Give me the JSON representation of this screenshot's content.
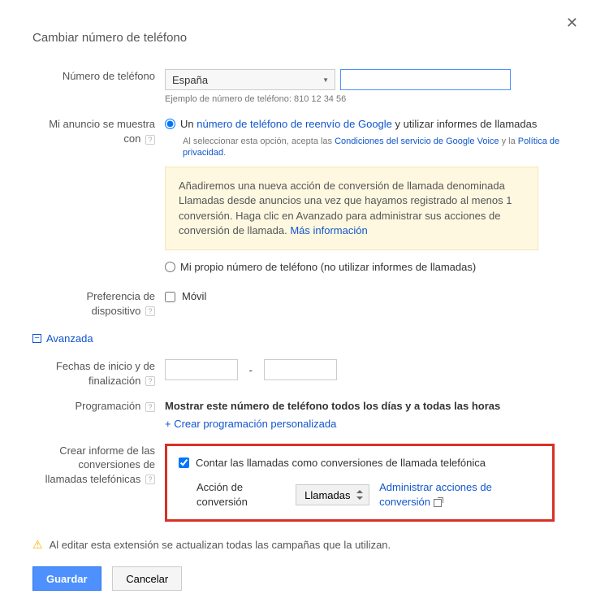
{
  "dialog": {
    "title": "Cambiar número de teléfono"
  },
  "phone": {
    "label": "Número de teléfono",
    "country": "España",
    "value": "",
    "example": "Ejemplo de número de teléfono: 810 12 34 56"
  },
  "display_with": {
    "label_line1": "Mi anuncio se muestra",
    "label_line2": "con",
    "option1_prefix": "Un ",
    "option1_link": "número de teléfono de reenvío de Google",
    "option1_suffix": " y utilizar informes de llamadas",
    "fineprint_prefix": "Al seleccionar esta opción, acepta las ",
    "fineprint_link1": "Condiciones del servicio de Google Voice",
    "fineprint_mid": " y la ",
    "fineprint_link2": "Política de privacidad",
    "fineprint_end": ".",
    "info_box": "Añadiremos una nueva acción de conversión de llamada denominada Llamadas desde anuncios una vez que hayamos registrado al menos 1 conversión. Haga clic en Avanzado para administrar sus acciones de conversión de llamada. ",
    "info_box_link": "Más información",
    "option2": "Mi propio número de teléfono (no utilizar informes de llamadas)"
  },
  "device_pref": {
    "label_line1": "Preferencia de",
    "label_line2": "dispositivo",
    "mobile": "Móvil"
  },
  "advanced": {
    "label": "Avanzada",
    "toggle_state": "−"
  },
  "dates": {
    "label_line1": "Fechas de inicio y de",
    "label_line2": "finalización",
    "start": "",
    "end": ""
  },
  "schedule": {
    "label": "Programación",
    "title": "Mostrar este número de teléfono todos los días y a todas las horas",
    "create_link": "+ Crear programación personalizada"
  },
  "report": {
    "label_line1": "Crear informe de las",
    "label_line2": "conversiones de",
    "label_line3": "llamadas telefónicas",
    "count_label": "Contar las llamadas como conversiones de llamada telefónica",
    "action_label": "Acción de conversión",
    "action_value": "Llamadas",
    "manage_link": "Administrar acciones de conversión"
  },
  "warning": "Al editar esta extensión se actualizan todas las campañas que la utilizan.",
  "buttons": {
    "save": "Guardar",
    "cancel": "Cancelar"
  }
}
